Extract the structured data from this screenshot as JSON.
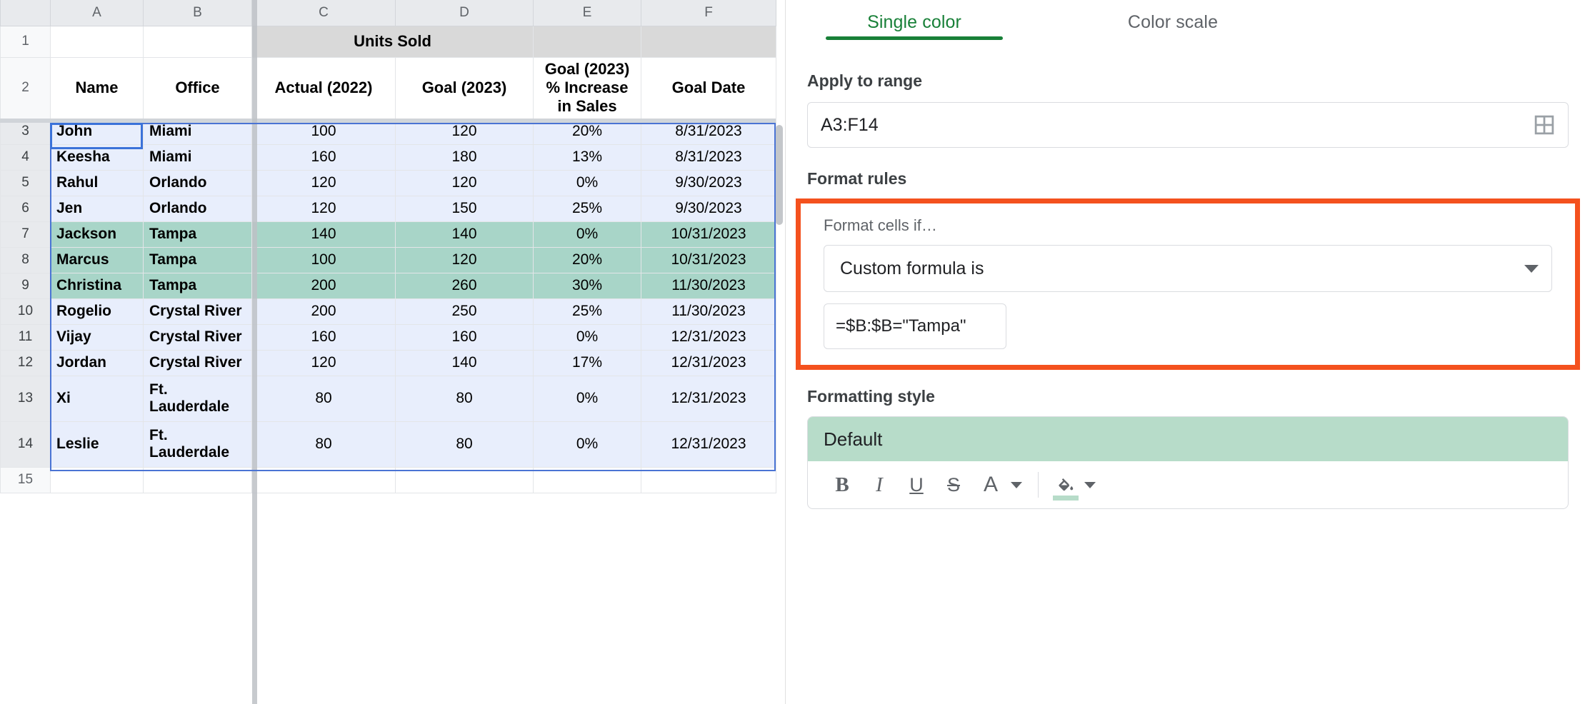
{
  "spreadsheet": {
    "column_headers": [
      "A",
      "B",
      "C",
      "D",
      "E",
      "F"
    ],
    "row_headers": [
      "1",
      "2",
      "3",
      "4",
      "5",
      "6",
      "7",
      "8",
      "9",
      "10",
      "11",
      "12",
      "13",
      "14",
      "15"
    ],
    "merged_title": "Units Sold",
    "header_row": {
      "a": "Name",
      "b": "Office",
      "c": "Actual (2022)",
      "d": "Goal (2023)",
      "e": "Goal (2023)\n% Increase\nin Sales",
      "e_line1": "Goal (2023)",
      "e_line2": "% Increase",
      "e_line3": "in Sales",
      "f": "Goal Date"
    },
    "rows": [
      {
        "row": "3",
        "name": "John",
        "office": "Miami",
        "actual": "100",
        "goal": "120",
        "increase": "20%",
        "date": "8/31/2023",
        "highlight": false
      },
      {
        "row": "4",
        "name": "Keesha",
        "office": "Miami",
        "actual": "160",
        "goal": "180",
        "increase": "13%",
        "date": "8/31/2023",
        "highlight": false
      },
      {
        "row": "5",
        "name": "Rahul",
        "office": "Orlando",
        "actual": "120",
        "goal": "120",
        "increase": "0%",
        "date": "9/30/2023",
        "highlight": false
      },
      {
        "row": "6",
        "name": "Jen",
        "office": "Orlando",
        "actual": "120",
        "goal": "150",
        "increase": "25%",
        "date": "9/30/2023",
        "highlight": false
      },
      {
        "row": "7",
        "name": "Jackson",
        "office": "Tampa",
        "actual": "140",
        "goal": "140",
        "increase": "0%",
        "date": "10/31/2023",
        "highlight": true
      },
      {
        "row": "8",
        "name": "Marcus",
        "office": "Tampa",
        "actual": "100",
        "goal": "120",
        "increase": "20%",
        "date": "10/31/2023",
        "highlight": true
      },
      {
        "row": "9",
        "name": "Christina",
        "office": "Tampa",
        "actual": "200",
        "goal": "260",
        "increase": "30%",
        "date": "11/30/2023",
        "highlight": true
      },
      {
        "row": "10",
        "name": "Rogelio",
        "office": "Crystal River",
        "actual": "200",
        "goal": "250",
        "increase": "25%",
        "date": "11/30/2023",
        "highlight": false
      },
      {
        "row": "11",
        "name": "Vijay",
        "office": "Crystal River",
        "actual": "160",
        "goal": "160",
        "increase": "0%",
        "date": "12/31/2023",
        "highlight": false
      },
      {
        "row": "12",
        "name": "Jordan",
        "office": "Crystal River",
        "actual": "120",
        "goal": "140",
        "increase": "17%",
        "date": "12/31/2023",
        "highlight": false
      },
      {
        "row": "13",
        "name": "Xi",
        "office": "Ft. Lauderdale",
        "actual": "80",
        "goal": "80",
        "increase": "0%",
        "date": "12/31/2023",
        "highlight": false
      },
      {
        "row": "14",
        "name": "Leslie",
        "office": "Ft. Lauderdale",
        "actual": "80",
        "goal": "80",
        "increase": "0%",
        "date": "12/31/2023",
        "highlight": false
      }
    ],
    "colors": {
      "highlight_fill": "#a8d5c8",
      "range_fill": "#e8eefc",
      "merged_fill": "#d9d9d9",
      "selection_border": "#4a74d4"
    }
  },
  "panel": {
    "tabs": [
      {
        "label": "Single color",
        "active": true
      },
      {
        "label": "Color scale",
        "active": false
      }
    ],
    "apply_to_range": {
      "label": "Apply to range",
      "value": "A3:F14",
      "icon": "select-range-grid-icon"
    },
    "format_rules": {
      "label": "Format rules",
      "condition_label": "Format cells if…",
      "condition_value": "Custom formula is",
      "formula_value": "=$B:$B=\"Tampa\"",
      "highlight_color": "#f4511e"
    },
    "formatting_style": {
      "label": "Formatting style",
      "preview_text": "Default",
      "preview_fill": "#b7dcc9",
      "toolbar": [
        {
          "name": "bold",
          "glyph": "B"
        },
        {
          "name": "italic",
          "glyph": "I"
        },
        {
          "name": "underline",
          "glyph": "U"
        },
        {
          "name": "strikethrough",
          "glyph": "S"
        },
        {
          "name": "text-color",
          "glyph": "A"
        },
        {
          "name": "fill-color",
          "glyph": ""
        }
      ]
    }
  }
}
